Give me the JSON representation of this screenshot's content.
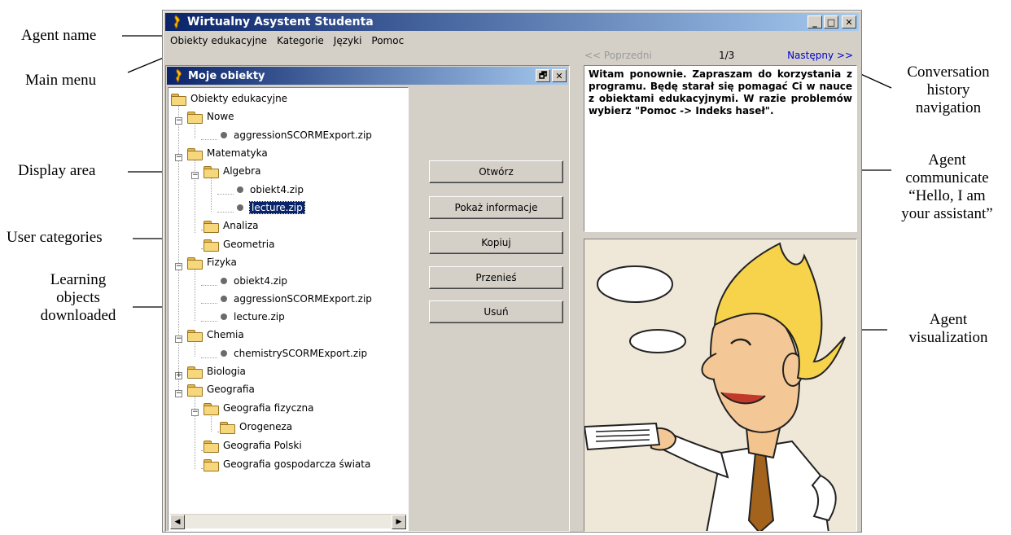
{
  "annotations": {
    "agent_name": "Agent name",
    "main_menu": "Main menu",
    "display_area": "Display area",
    "user_categories": "User categories",
    "learning_objects": [
      "Learning",
      "objects",
      "downloaded"
    ],
    "conversation_history": [
      "Conversation",
      "history",
      "navigation"
    ],
    "agent_communicate": [
      "Agent",
      "communicate",
      "“Hello, I am",
      "your assistant”"
    ],
    "agent_visualization": [
      "Agent",
      "visualization"
    ]
  },
  "window": {
    "title": "Wirtualny Asystent Studenta",
    "minimize": "_",
    "maximize": "□",
    "close": "✕"
  },
  "menu": [
    "Obiekty edukacyjne",
    "Kategorie",
    "Języki",
    "Pomoc"
  ],
  "panel": {
    "title": "Moje obiekty",
    "restore": "🗗",
    "close": "✕"
  },
  "tree": [
    "Obiekty edukacyjne",
    "Nowe",
    "aggressionSCORMExport.zip",
    "Matematyka",
    "Algebra",
    "obiekt4.zip",
    "lecture.zip",
    "Analiza",
    "Geometria",
    "Fizyka",
    "obiekt4.zip",
    "aggressionSCORMExport.zip",
    "lecture.zip",
    "Chemia",
    "chemistrySCORMExport.zip",
    "Biologia",
    "Geografia",
    "Geografia fizyczna",
    "Orogeneza",
    "Geografia Polski",
    "Geografia gospodarcza świata"
  ],
  "scroll": {
    "left": "◀",
    "right": "▶"
  },
  "buttons": {
    "open": "Otwórz",
    "info": "Pokaż informacje",
    "copy": "Kopiuj",
    "move": "Przenieś",
    "delete": "Usuń"
  },
  "history": {
    "prev": "<< Poprzedni",
    "count": "1/3",
    "next": "Następny >>"
  },
  "message": "Witam ponownie. Zapraszam do korzystania z programu. Będę starał się pomagać Ci w nauce z obiektami edukacyjnymi. W razie problemów wybierz \"Pomoc -> Indeks haseł\"."
}
